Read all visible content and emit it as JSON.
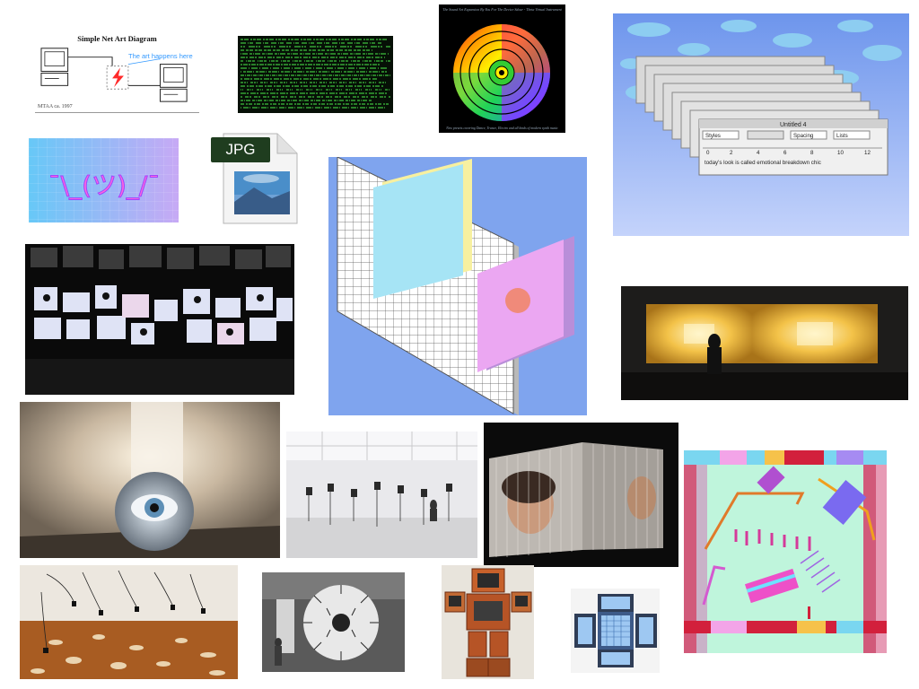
{
  "diagram": {
    "title": "Simple Net Art Diagram",
    "caption": "The art happens here",
    "credit": "MTAA ca. 1997"
  },
  "wheel": {
    "top_text": "The Sound Art Expansion By You For The Device Sdour - Theta Virtual Instrument",
    "bottom_text": "New presets covering Dance, Trance, Electro and all kinds of modern synth music"
  },
  "windows": {
    "title": "Untitled 4",
    "styles_label": "Styles",
    "spacing_label": "Spacing",
    "lists_label": "Lists",
    "ruler_numbers": [
      "0",
      "2",
      "4",
      "6",
      "8",
      "10",
      "12"
    ],
    "body_text": "today's look is called emotional breakdown chic"
  },
  "shrug": {
    "text": "¯\\_(ツ)_/¯"
  },
  "jpg": {
    "label": "JPG"
  },
  "colors": {
    "grid_bg": "#7fa4ee",
    "panel_cyan": "#a6e4f5",
    "panel_yellow": "#f7f0a0",
    "panel_pink": "#eba7f2",
    "panel_dot": "#f08a7a",
    "sky": "#6d95ec",
    "code_green": "#3fbf3f"
  },
  "icons": {
    "jpg_file": "jpg-file-icon",
    "computer_left": "computer-icon",
    "computer_right": "computer-icon",
    "lightning": "lightning-icon"
  }
}
